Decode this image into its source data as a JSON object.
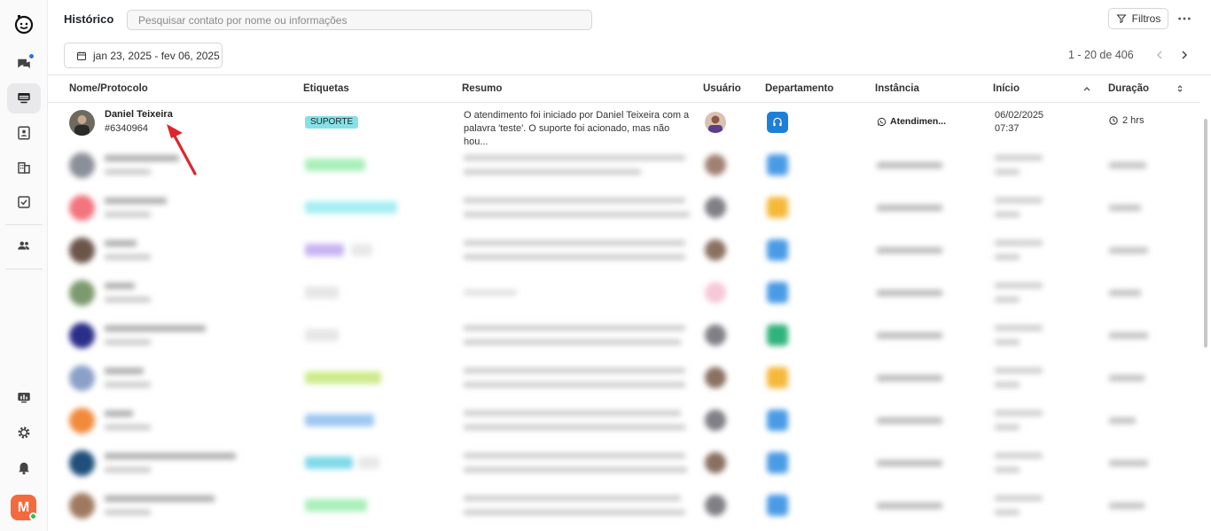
{
  "header": {
    "title": "Histórico",
    "search_placeholder": "Pesquisar contato por nome ou informações",
    "filter_label": "Filtros",
    "date_range": "jan 23, 2025 - fev 06, 2025",
    "pagination": "1 - 20 de 406"
  },
  "sidebar": {
    "avatar_letter": "M",
    "items": [
      "chat-icon",
      "monitor-icon",
      "contacts-icon",
      "building-icon",
      "tasks-icon",
      "team-icon",
      "dashboard-icon",
      "gear-icon",
      "bell-icon"
    ]
  },
  "table": {
    "columns": {
      "name": "Nome/Protocolo",
      "tags": "Etiquetas",
      "summary": "Resumo",
      "user": "Usuário",
      "department": "Departamento",
      "instance": "Instância",
      "start": "Início",
      "duration": "Duração"
    },
    "rows": [
      {
        "name": "Daniel Teixeira",
        "protocol": "#6340964",
        "tag": "SUPORTE",
        "summary": "O atendimento foi iniciado por Daniel Teixeira com a palavra 'teste'. O suporte foi acionado, mas não hou...",
        "instance": "Atendimen...",
        "start_date": "06/02/2025",
        "start_time": "07:37",
        "duration": "2 hrs"
      }
    ]
  },
  "colors": {
    "accent": "#2f6fe8",
    "tag_suporte": "#86e1e6",
    "dept_blue": "#1d7fd8",
    "sidebar_avatar": "#f26a3d",
    "arrow": "#e0242b"
  }
}
